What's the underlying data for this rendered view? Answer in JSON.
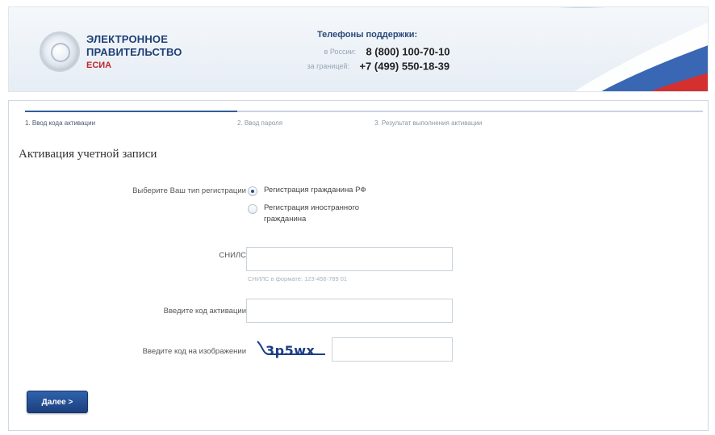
{
  "header": {
    "logo_line1": "ЭЛЕКТРОННОЕ",
    "logo_line2": "ПРАВИТЕЛЬСТВО",
    "logo_sub": "ЕСИА",
    "support_title": "Телефоны поддержки:",
    "phones": [
      {
        "label": "в России:",
        "number": "8 (800) 100-70-10"
      },
      {
        "label": "за границей:",
        "number": "+7 (499) 550-18-39"
      }
    ]
  },
  "steps": [
    {
      "label": "1. Ввод кода активации",
      "active": true
    },
    {
      "label": "2. Ввод пароля",
      "active": false
    },
    {
      "label": "3. Результат выполнения активации",
      "active": false
    }
  ],
  "form": {
    "title": "Активация учетной записи",
    "registration_type_label": "Выберите Ваш тип регистрации",
    "options": [
      {
        "label": "Регистрация гражданина РФ",
        "checked": true
      },
      {
        "label_line1": "Регистрация иностранного",
        "label_line2": "гражданина",
        "checked": false
      }
    ],
    "snils_label": "СНИЛС",
    "snils_value": "",
    "snils_hint": "СНИЛС в формате: 123-456-789 01",
    "activation_label": "Введите код активации",
    "activation_value": "",
    "captcha_label": "Введите код на изображении",
    "captcha_text": "3p5wx",
    "captcha_value": "",
    "submit_label": "Далее >"
  },
  "colors": {
    "brand_blue": "#1f3f77",
    "accent_red": "#c0272d",
    "button_blue": "#2f62ad"
  }
}
